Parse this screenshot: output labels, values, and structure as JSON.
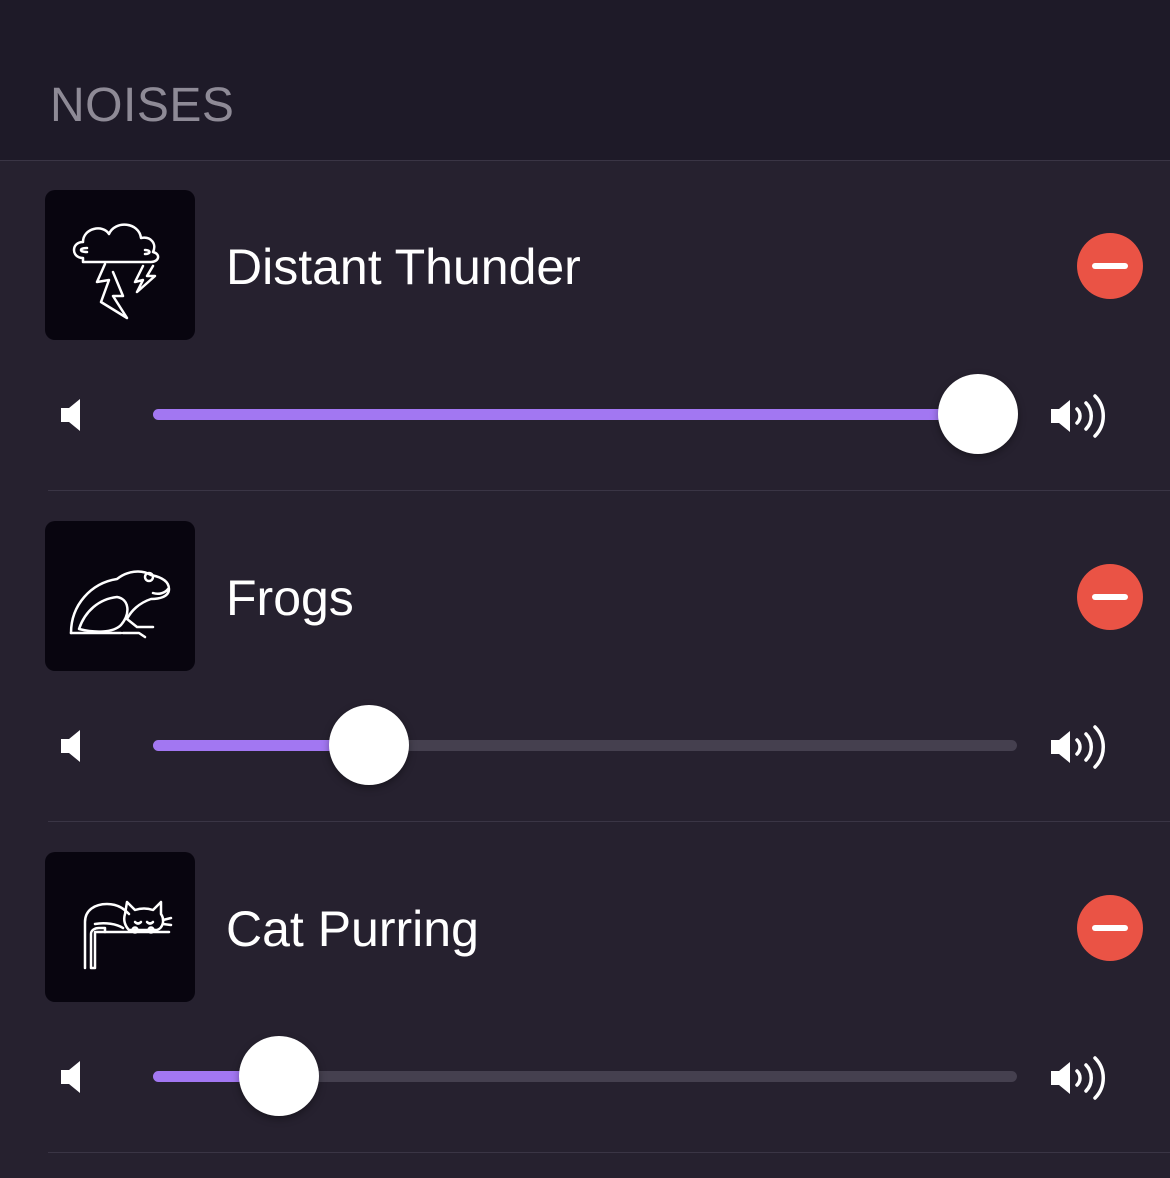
{
  "header": {
    "title": "NOISES"
  },
  "noises": [
    {
      "name": "Distant Thunder",
      "icon": "thunderstorm-cloud-icon",
      "volume": 0.955
    },
    {
      "name": "Frogs",
      "icon": "frog-icon",
      "volume": 0.25
    },
    {
      "name": "Cat Purring",
      "icon": "sleeping-cat-icon",
      "volume": 0.146
    }
  ],
  "colors": {
    "background": "#26212f",
    "header_background": "#1e1a28",
    "accent": "#a277f2",
    "remove": "#ea5345",
    "track": "#45404f"
  }
}
